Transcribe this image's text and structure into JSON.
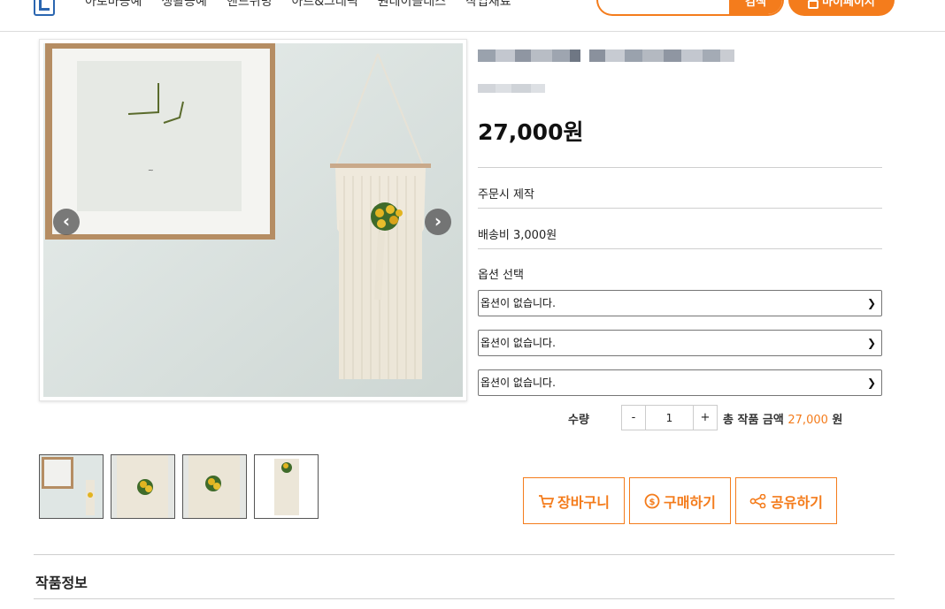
{
  "header": {
    "nav": [
      "아로마공예",
      "생활공예",
      "핸드위빙",
      "아트&그래픽",
      "원데이클래스",
      "작업재료"
    ],
    "search_button": "검색",
    "search_placeholder": "",
    "mypage_button": "마이페이지"
  },
  "gallery": {
    "prev_icon": "chevron-left-icon",
    "next_icon": "chevron-right-icon",
    "thumbnail_count": 4
  },
  "product": {
    "price": "27,000원",
    "made_to_order": "주문시 제작",
    "shipping": "배송비 3,000원",
    "option_label": "옵션 선택",
    "options": [
      "옵션이 없습니다.",
      "옵션이 없습니다.",
      "옵션이 없습니다."
    ],
    "quantity_label": "수량",
    "quantity_minus": "-",
    "quantity_value": "1",
    "quantity_plus": "+",
    "total_label": "총 작품 금액",
    "total_amount": "27,000",
    "total_unit": "원"
  },
  "actions": {
    "cart": "장바구니",
    "buy": "구매하기",
    "share": "공유하기"
  },
  "section": {
    "title": "작품정보"
  },
  "colors": {
    "accent": "#f47c1c",
    "logo": "#2b66b0"
  }
}
